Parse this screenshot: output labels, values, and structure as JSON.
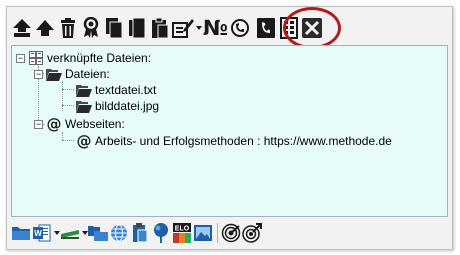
{
  "toolbar_top": {
    "numero_symbol": "№",
    "icons": [
      "arrow-up-icon",
      "arrow-up-icon",
      "trash-icon",
      "award-icon",
      "copy-icon",
      "copy-icon",
      "paste-icon",
      "edit-icon",
      "number-icon",
      "phone-icon",
      "phone-icon",
      "barcode-icon",
      "close-icon"
    ]
  },
  "tree": {
    "root": {
      "label": "verknüpfte Dateien:"
    },
    "files_folder": {
      "label": "Dateien:"
    },
    "files": [
      {
        "label": "textdatei.txt"
      },
      {
        "label": "bilddatei.jpg"
      }
    ],
    "web_folder": {
      "label": "Webseiten:"
    },
    "web_items": [
      {
        "label": "Arbeits- und Erfolgsmethoden : https://www.methode.de"
      }
    ],
    "at_symbol": "@"
  },
  "toolbar_bottom": {
    "elo_label": "ELO",
    "colors": {
      "accent_blue": "#1f5fa8",
      "accent_green": "#2e8b3a",
      "highlight_ring": "#b01c1c"
    }
  }
}
